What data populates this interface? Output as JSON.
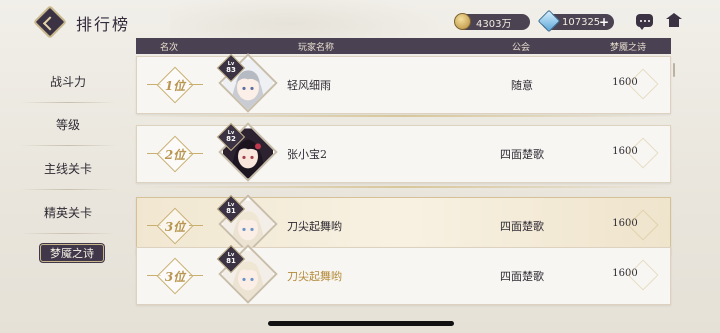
{
  "header": {
    "title": "排行榜",
    "gold": "4303万",
    "gems": "107325"
  },
  "icons": {
    "back": "back-arrow-icon",
    "gold": "coin-icon",
    "gem": "gem-icon",
    "plus": "plus-icon",
    "chat": "chat-icon",
    "home": "home-icon"
  },
  "sidebar": {
    "items": [
      {
        "label": "战斗力"
      },
      {
        "label": "等级"
      },
      {
        "label": "主线关卡"
      },
      {
        "label": "精英关卡"
      },
      {
        "label": "梦魇之诗"
      }
    ],
    "active_index": 4
  },
  "table": {
    "columns": [
      "名次",
      "玩家名称",
      "公会",
      "梦魇之诗"
    ],
    "rows": [
      {
        "rank": "1位",
        "lv_prefix": "Lv",
        "level": "83",
        "name": "轻风细雨",
        "guild": "随意",
        "score": "1600"
      },
      {
        "rank": "2位",
        "lv_prefix": "Lv",
        "level": "82",
        "name": "张小宝2",
        "guild": "四面楚歌",
        "score": "1600"
      },
      {
        "rank": "3位",
        "lv_prefix": "Lv",
        "level": "81",
        "name": "刀尖起舞哟",
        "guild": "四面楚歌",
        "score": "1600"
      },
      {
        "rank": "3位",
        "lv_prefix": "Lv",
        "level": "81",
        "name": "刀尖起舞哟",
        "guild": "四面楚歌",
        "score": "1600"
      }
    ]
  },
  "colors": {
    "dark": "#3b3344",
    "gold": "#c9b78c",
    "highlight": "#f1e7d1",
    "self_name": "#b58b3c"
  }
}
